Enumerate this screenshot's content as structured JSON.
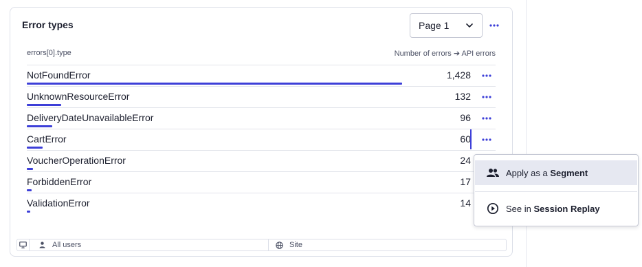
{
  "card": {
    "title": "Error types",
    "page_select": {
      "value": "Page 1"
    }
  },
  "table": {
    "columns": {
      "left": "errors[0].type",
      "right": "Number of errors ➔ API errors"
    },
    "max_value": 1428,
    "rows": [
      {
        "label": "NotFoundError",
        "value": "1,428",
        "numeric": 1428
      },
      {
        "label": "UnknownResourceError",
        "value": "132",
        "numeric": 132
      },
      {
        "label": "DeliveryDateUnavailableError",
        "value": "96",
        "numeric": 96
      },
      {
        "label": "CartError",
        "value": "60",
        "numeric": 60
      },
      {
        "label": "VoucherOperationError",
        "value": "24",
        "numeric": 24
      },
      {
        "label": "ForbiddenError",
        "value": "17",
        "numeric": 17
      },
      {
        "label": "ValidationError",
        "value": "14",
        "numeric": 14
      }
    ]
  },
  "footer": {
    "users": "All users",
    "site": "Site"
  },
  "context_menu": {
    "items": [
      {
        "prefix": "Apply as a ",
        "bold": "Segment",
        "icon": "users-icon"
      },
      {
        "prefix": "See in ",
        "bold": "Session Replay",
        "icon": "play-circle-icon"
      }
    ]
  },
  "colors": {
    "accent": "#3d3fd8",
    "text": "#1c1f2e",
    "muted": "#4a4f63",
    "border": "#dcdfe8",
    "hover": "#e6e8f1"
  }
}
